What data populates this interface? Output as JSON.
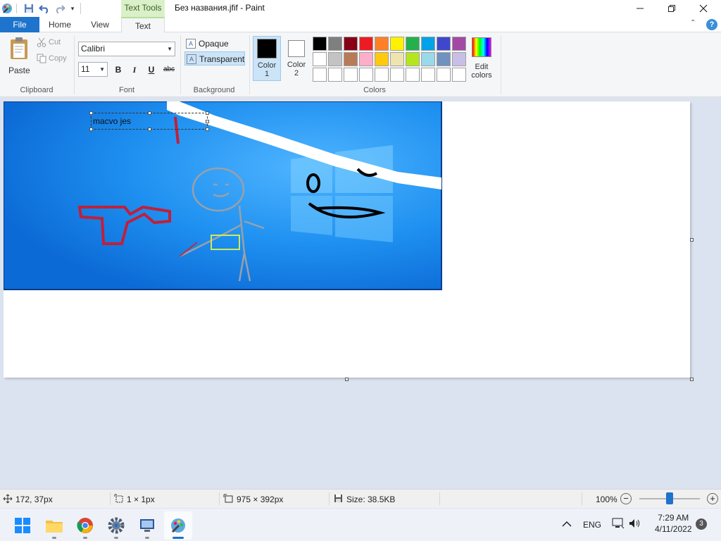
{
  "window": {
    "title": "Без названия.jfif - Paint",
    "context_tab_group": "Text Tools"
  },
  "tabs": {
    "file": "File",
    "home": "Home",
    "view": "View",
    "text": "Text"
  },
  "ribbon": {
    "clipboard": {
      "paste": "Paste",
      "cut": "Cut",
      "copy": "Copy",
      "label": "Clipboard"
    },
    "font": {
      "family": "Calibri",
      "size": "11",
      "bold": "B",
      "italic": "I",
      "underline": "U",
      "strike": "abc",
      "label": "Font"
    },
    "background": {
      "opaque": "Opaque",
      "transparent": "Transparent",
      "label": "Background"
    },
    "colors": {
      "color1": {
        "line1": "Color",
        "line2": "1",
        "value": "#000000"
      },
      "color2": {
        "line1": "Color",
        "line2": "2",
        "value": "#ffffff"
      },
      "edit_line1": "Edit",
      "edit_line2": "colors",
      "label": "Colors",
      "palette": [
        "#000000",
        "#7f7f7f",
        "#880015",
        "#ed1c24",
        "#ff7f27",
        "#fff200",
        "#22b14c",
        "#00a2e8",
        "#3f48cc",
        "#a349a4",
        "#ffffff",
        "#c3c3c3",
        "#b97a57",
        "#ffaec9",
        "#ffc90e",
        "#efe4b0",
        "#b5e61d",
        "#99d9ea",
        "#7092be",
        "#c8bfe7",
        "#ffffff",
        "#ffffff",
        "#ffffff",
        "#ffffff",
        "#ffffff",
        "#ffffff",
        "#ffffff",
        "#ffffff",
        "#ffffff",
        "#ffffff"
      ]
    }
  },
  "canvas": {
    "text_box_value": "macvo jes"
  },
  "statusbar": {
    "cursor_position": "172, 37px",
    "selection_size": "1 × 1px",
    "image_size": "975 × 392px",
    "file_size": "Size: 38.5KB",
    "zoom": "100%"
  },
  "taskbar": {
    "language": "ENG",
    "time": "7:29 AM",
    "date": "4/11/2022",
    "notifications": "3"
  }
}
